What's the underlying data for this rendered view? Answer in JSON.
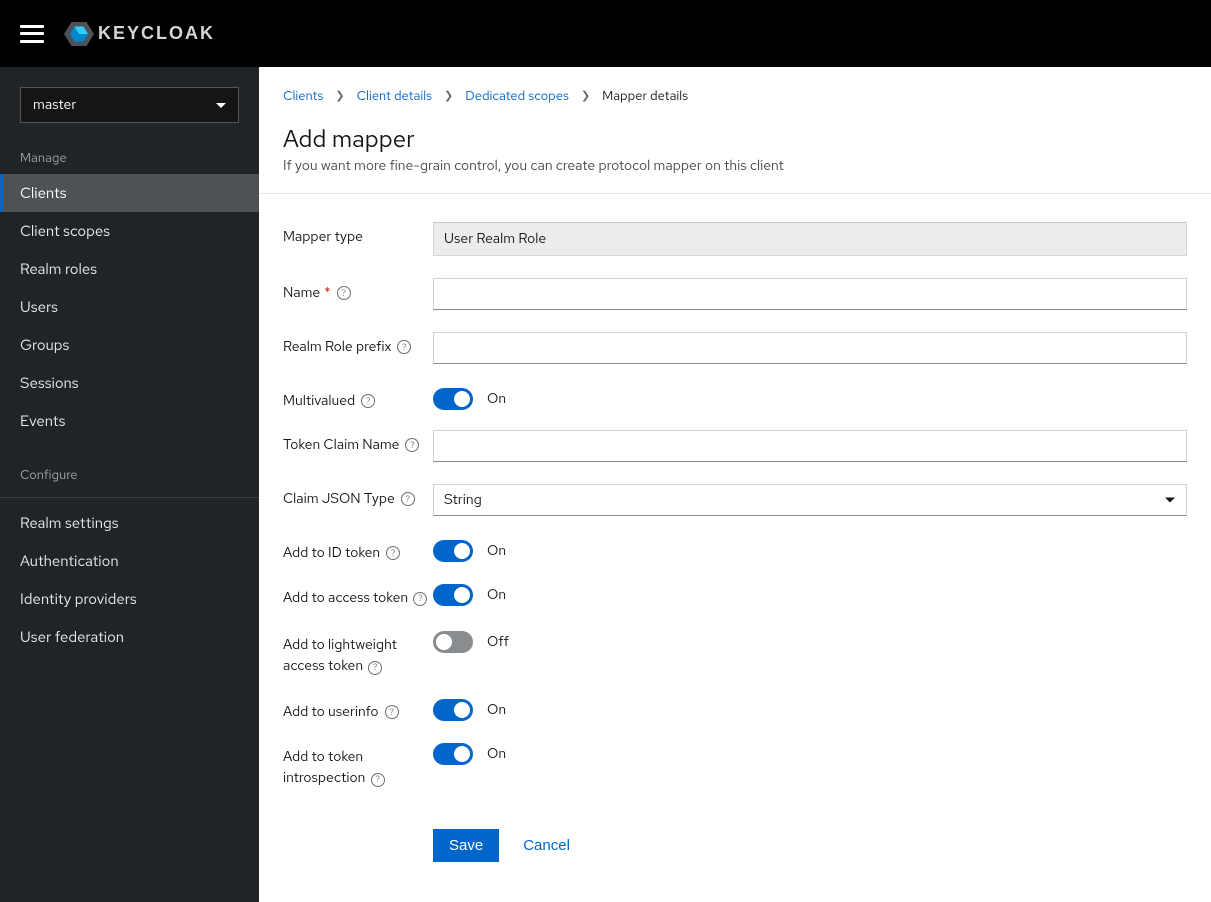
{
  "header": {
    "logo_text": "KEYCLOAK"
  },
  "sidebar": {
    "realm": "master",
    "section_manage": "Manage",
    "section_configure": "Configure",
    "items_manage": [
      {
        "label": "Clients",
        "active": true
      },
      {
        "label": "Client scopes",
        "active": false
      },
      {
        "label": "Realm roles",
        "active": false
      },
      {
        "label": "Users",
        "active": false
      },
      {
        "label": "Groups",
        "active": false
      },
      {
        "label": "Sessions",
        "active": false
      },
      {
        "label": "Events",
        "active": false
      }
    ],
    "items_configure": [
      {
        "label": "Realm settings"
      },
      {
        "label": "Authentication"
      },
      {
        "label": "Identity providers"
      },
      {
        "label": "User federation"
      }
    ]
  },
  "breadcrumb": {
    "items": [
      "Clients",
      "Client details",
      "Dedicated scopes"
    ],
    "current": "Mapper details"
  },
  "page": {
    "title": "Add mapper",
    "subtitle": "If you want more fine-grain control, you can create protocol mapper on this client"
  },
  "form": {
    "mapper_type_label": "Mapper type",
    "mapper_type_value": "User Realm Role",
    "name_label": "Name",
    "name_value": "",
    "realm_role_prefix_label": "Realm Role prefix",
    "realm_role_prefix_value": "",
    "multivalued_label": "Multivalued",
    "multivalued_on": true,
    "token_claim_name_label": "Token Claim Name",
    "token_claim_name_value": "",
    "claim_json_type_label": "Claim JSON Type",
    "claim_json_type_value": "String",
    "add_id_token_label": "Add to ID token",
    "add_id_token_on": true,
    "add_access_token_label": "Add to access token",
    "add_access_token_on": true,
    "add_lightweight_label_line1": "Add to lightweight",
    "add_lightweight_label_line2": "access token",
    "add_lightweight_on": false,
    "add_userinfo_label": "Add to userinfo",
    "add_userinfo_on": true,
    "add_introspection_label_line1": "Add to token",
    "add_introspection_label_line2": "introspection",
    "add_introspection_on": true,
    "on_text": "On",
    "off_text": "Off"
  },
  "actions": {
    "save": "Save",
    "cancel": "Cancel"
  }
}
